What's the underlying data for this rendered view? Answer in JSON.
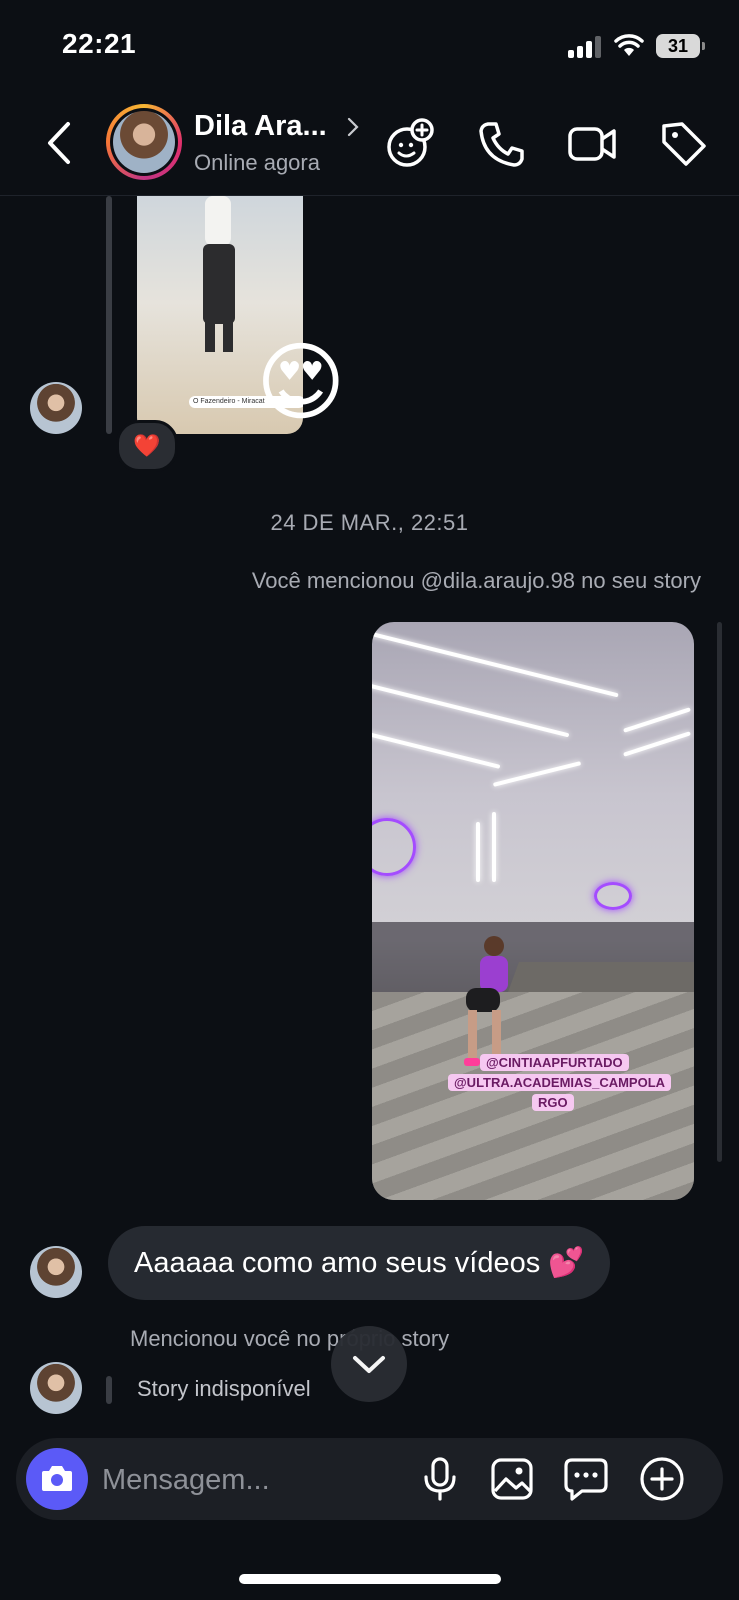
{
  "status_bar": {
    "time": "22:21",
    "battery": "31"
  },
  "header": {
    "contact_name": "Dila Ara...",
    "presence": "Online agora",
    "icons": [
      "back-arrow-icon",
      "avatar",
      "add-effect-icon",
      "phone-icon",
      "video-camera-icon",
      "tag-icon"
    ]
  },
  "conversation": {
    "story_location_tag": "O Fazendeiro - Miracat",
    "reaction_emoji": "😍",
    "heart_reaction": "❤️",
    "timestamp": "24 DE MAR., 22:51",
    "mention_note": "Você mencionou @dila.araujo.98 no seu story",
    "story_tags": [
      "@CINTIAAPFURTADO",
      "@ULTRA.ACADEMIAS_CAMPOLA",
      "RGO"
    ],
    "message_text": "Aaaaaa como amo seus vídeos 💕",
    "mentioned_you_note": "Mencionou você no próprio story",
    "story_unavailable": "Story indisponível"
  },
  "composer": {
    "placeholder": "Mensagem...",
    "icons": [
      "camera-icon",
      "microphone-icon",
      "gallery-icon",
      "sticker-chat-icon",
      "plus-icon"
    ]
  },
  "colors": {
    "background": "#0c0f14",
    "bubble": "#262a31",
    "camera_button": "#5b5af7",
    "muted_text": "#a8abb3"
  }
}
